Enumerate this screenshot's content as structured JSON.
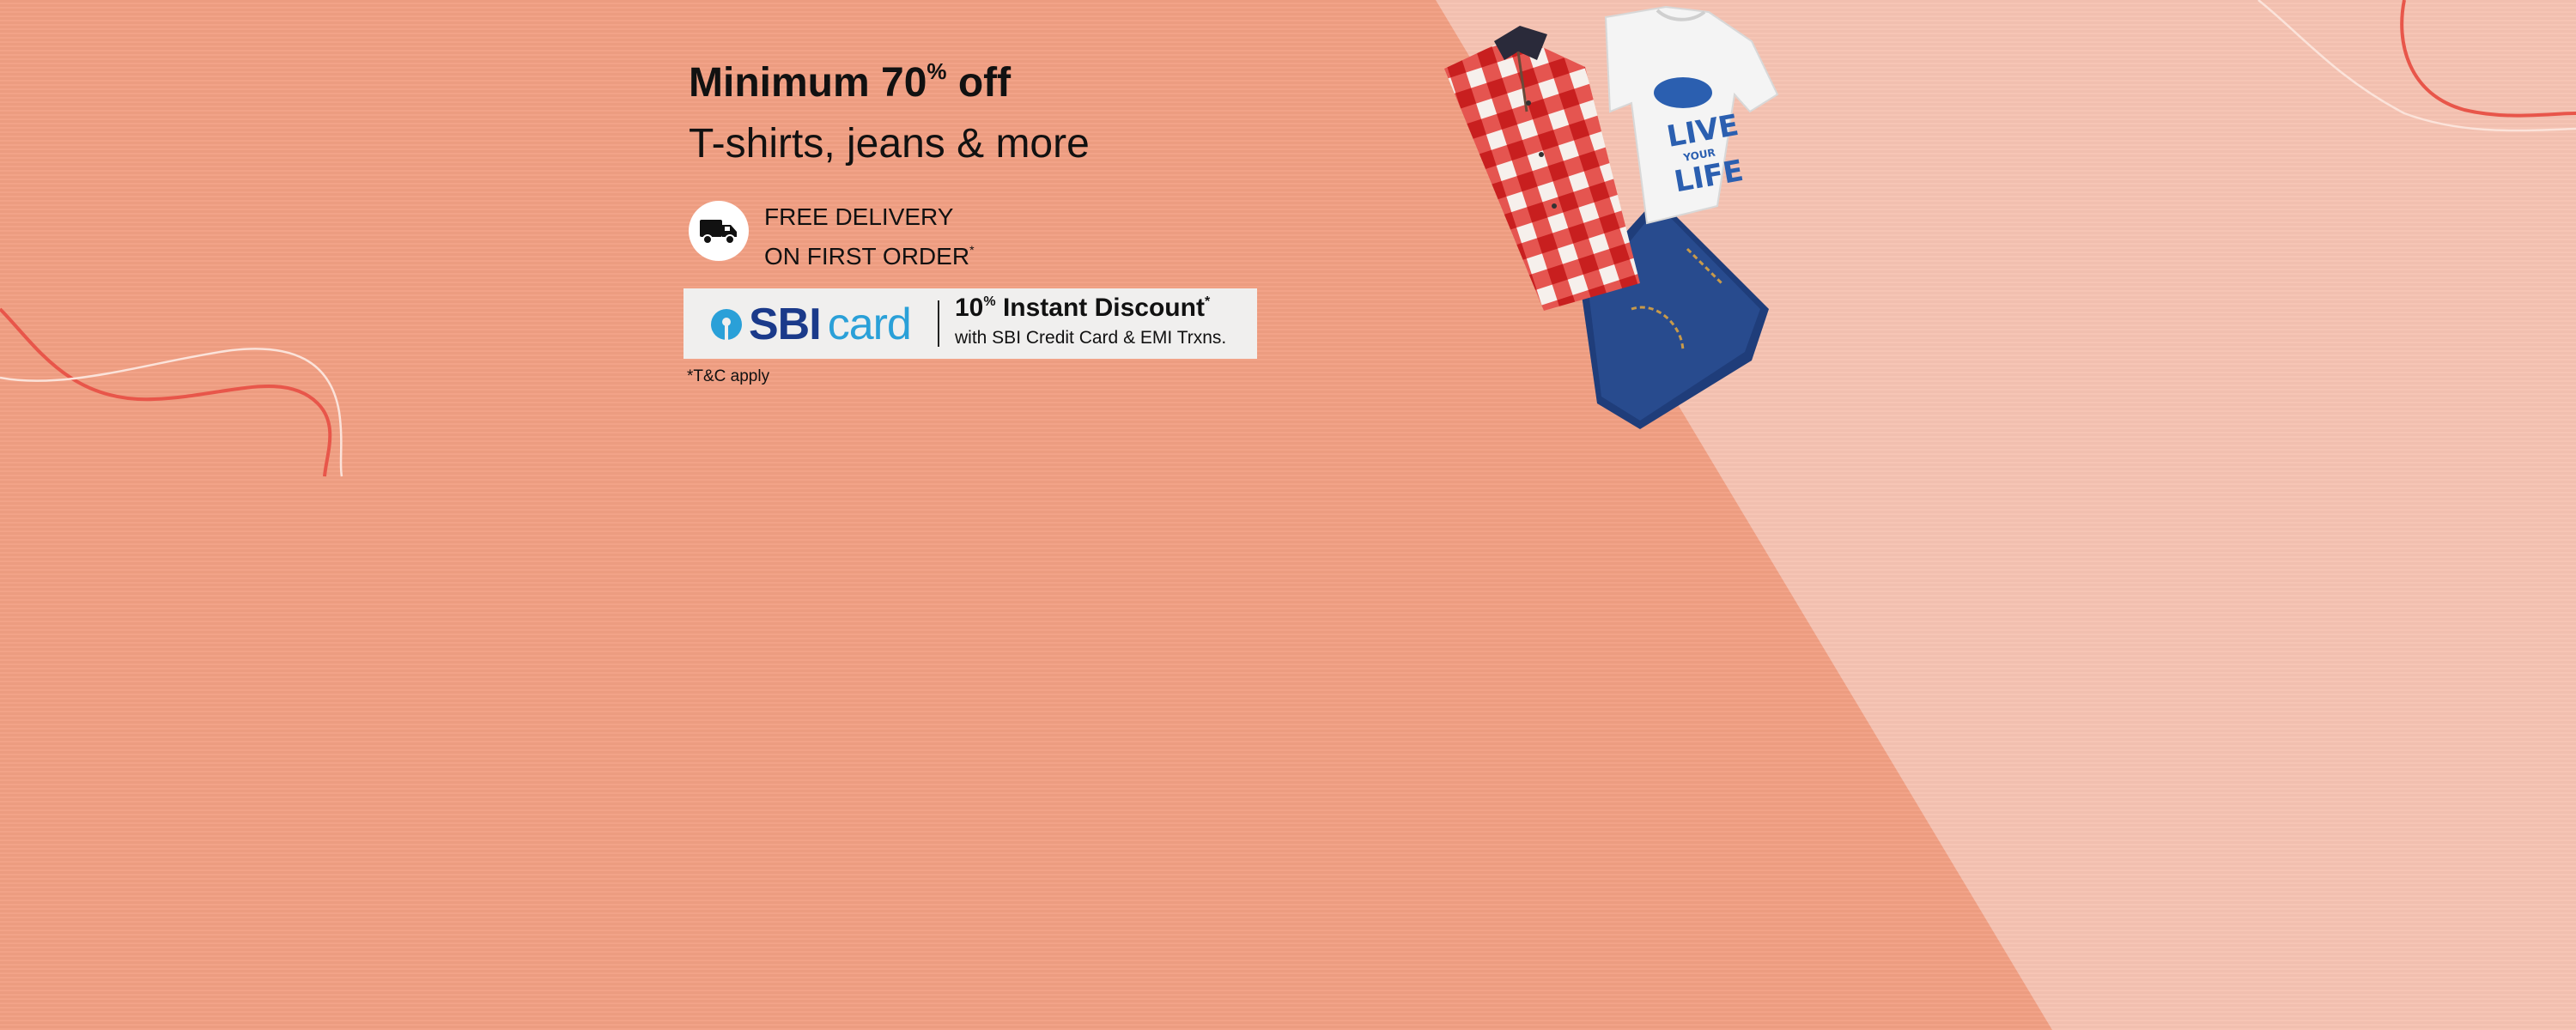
{
  "banner": {
    "headline": {
      "prefix": "Minimum 70",
      "percent": "%",
      "suffix": " off"
    },
    "subhead": "T-shirts, jeans & more",
    "delivery": {
      "icon": "delivery-truck-icon",
      "line1": "FREE DELIVERY",
      "line2": "ON FIRST ORDER",
      "asterisk": "*"
    },
    "bank_offer": {
      "brand_sbi": "SBI",
      "brand_card": "card",
      "discount_prefix": "10",
      "discount_percent": "%",
      "discount_suffix": " Instant Discount",
      "asterisk": "*",
      "note": "with SBI Credit Card & EMI Trxns."
    },
    "terms": "*T&C apply",
    "tshirt_print": {
      "line1": "LIVE",
      "line2": "YOUR",
      "line3": "LIFE"
    },
    "colors": {
      "background_dark": "#f19f83",
      "background_light": "#f6c3b2",
      "accent_line": "#e8564a",
      "sbi_blue": "#1b3a8a",
      "sbi_light_blue": "#2aa0d8"
    }
  }
}
